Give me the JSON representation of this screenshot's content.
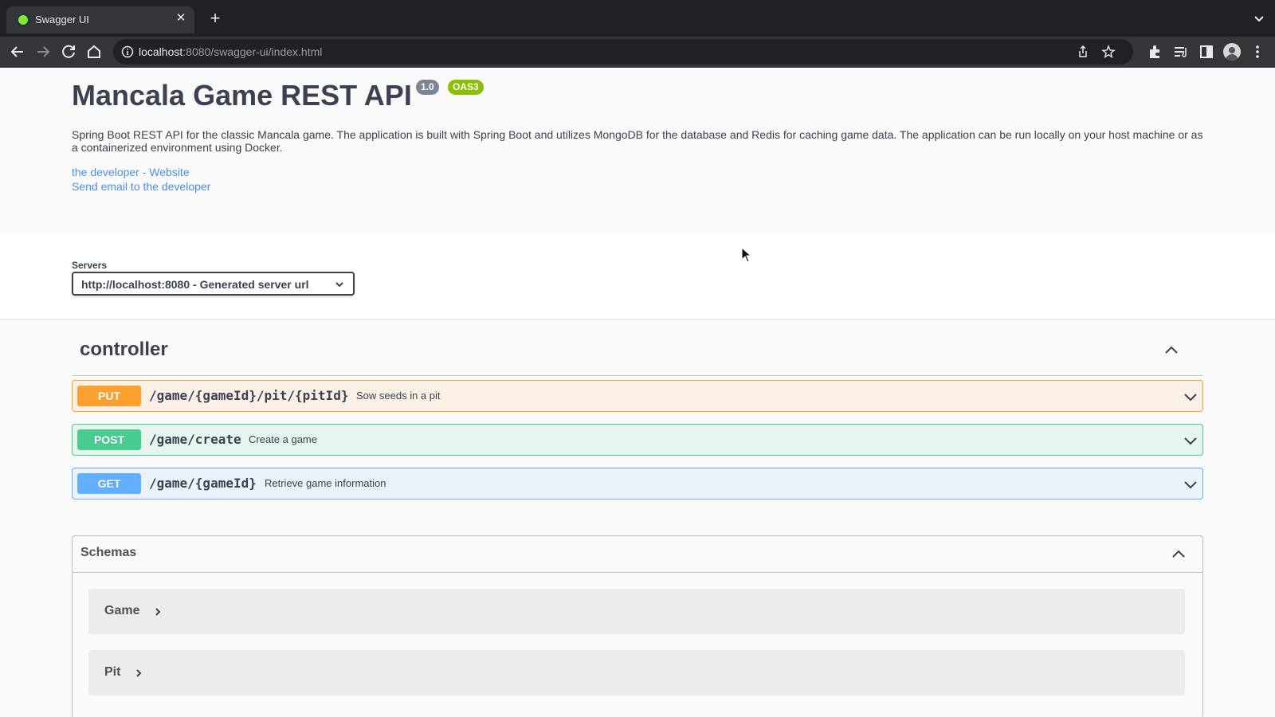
{
  "browser": {
    "tab_title": "Swagger UI",
    "url_host": "localhost",
    "url_rest": ":8080/swagger-ui/index.html"
  },
  "info": {
    "title": "Mancala Game REST API",
    "version": "1.0",
    "spec_badge": "OAS3",
    "description": "Spring Boot REST API for the classic Mancala game. The application is built with Spring Boot and utilizes MongoDB for the database and Redis for caching game data. The application can be run locally on your host machine or as a containerized environment using Docker.",
    "links": {
      "website": "the developer - Website",
      "email": "Send email to the developer"
    }
  },
  "servers": {
    "label": "Servers",
    "selected": "http://localhost:8080 - Generated server url"
  },
  "tag": {
    "name": "controller"
  },
  "operations": [
    {
      "method": "PUT",
      "path": "/game/{gameId}/pit/{pitId}",
      "summary": "Sow seeds in a pit",
      "color": "#fca130"
    },
    {
      "method": "POST",
      "path": "/game/create",
      "summary": "Create a game",
      "color": "#49cc90"
    },
    {
      "method": "GET",
      "path": "/game/{gameId}",
      "summary": "Retrieve game information",
      "color": "#61affe"
    }
  ],
  "schemas": {
    "title": "Schemas",
    "models": [
      "Game",
      "Pit"
    ]
  },
  "colors": {
    "text": "#3b4151",
    "link": "#4990e2",
    "version_badge": "#7d8492",
    "oas_badge": "#89bf04"
  }
}
